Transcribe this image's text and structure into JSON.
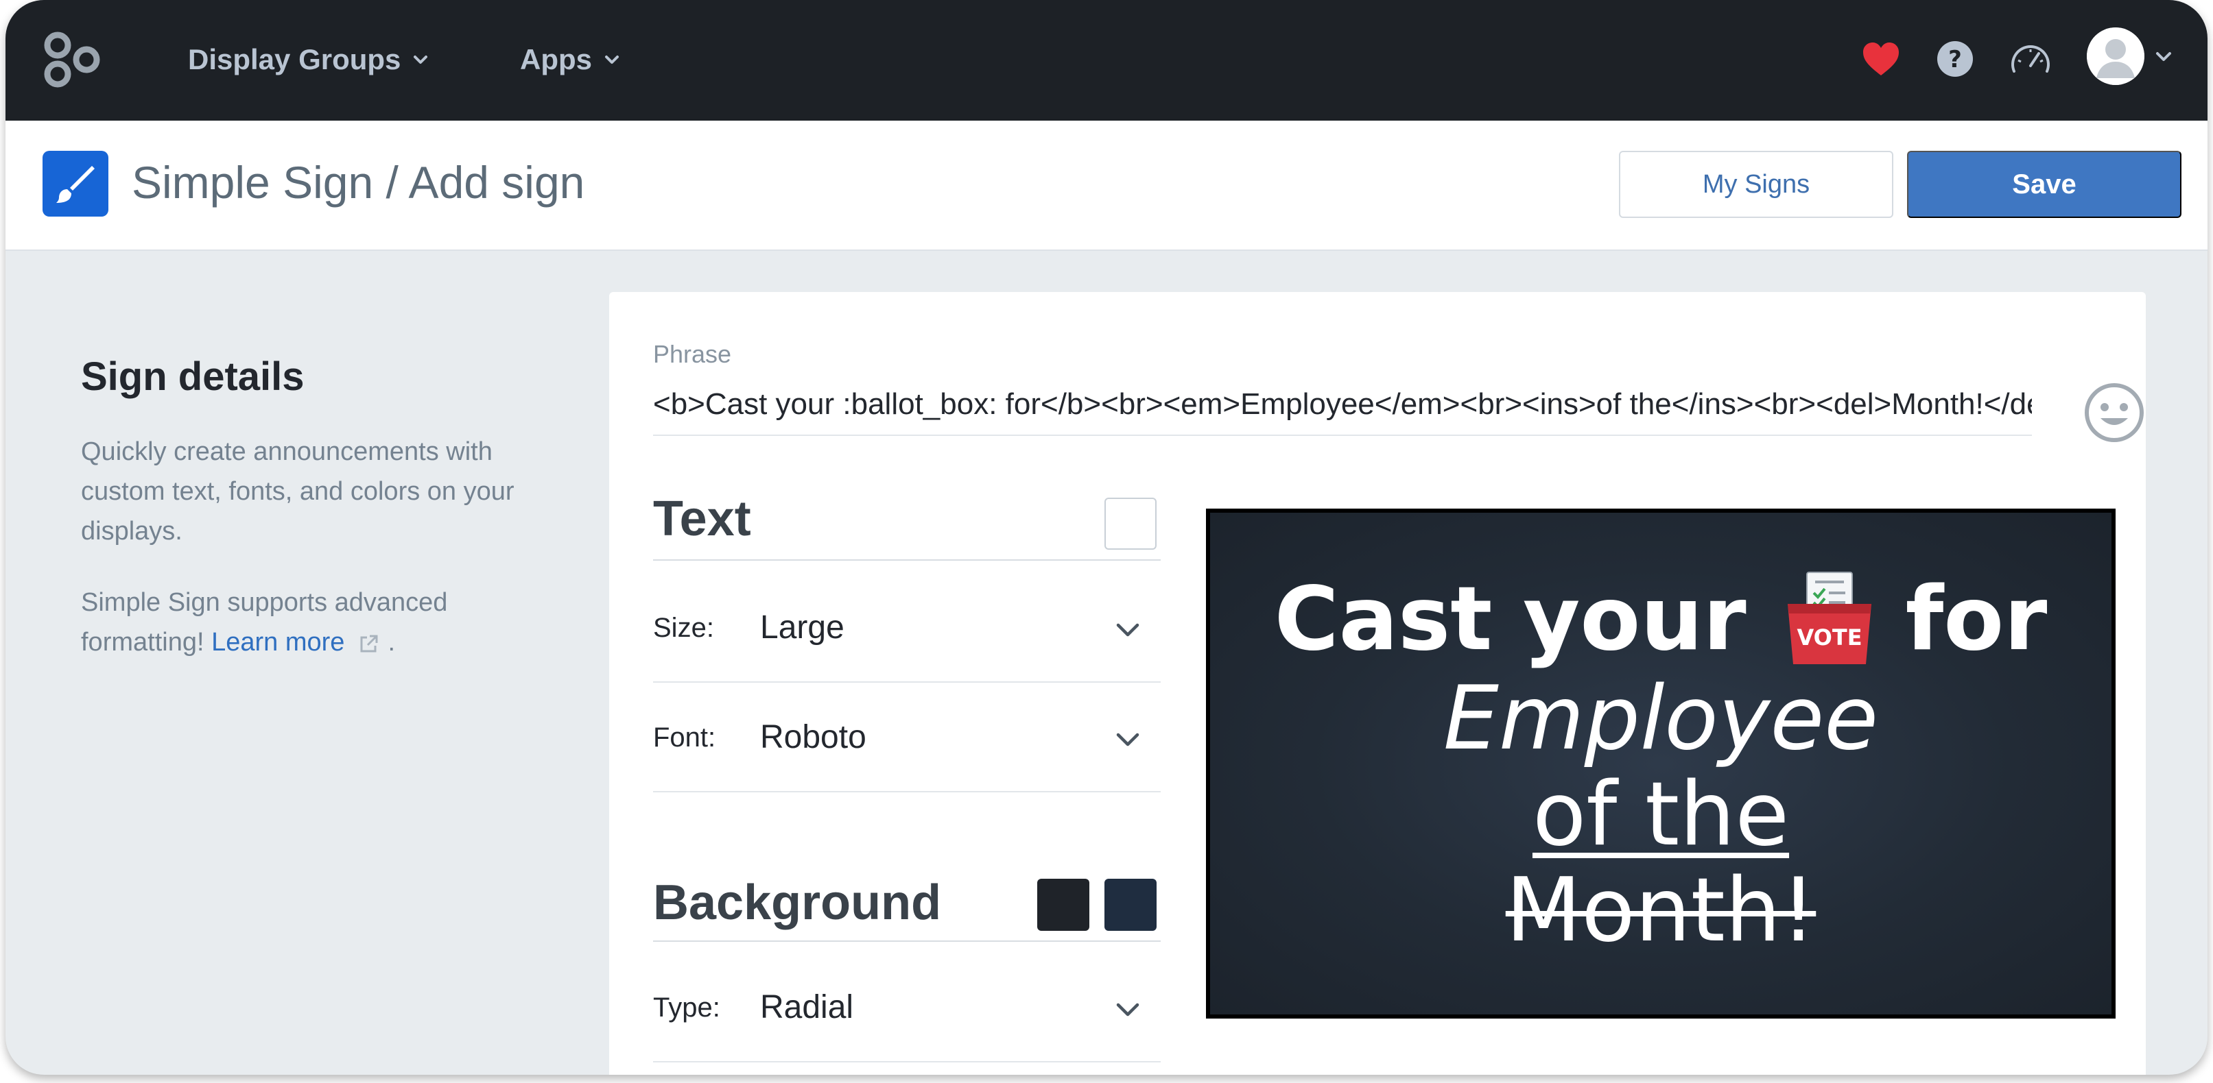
{
  "nav": {
    "items": [
      {
        "label": "Display Groups"
      },
      {
        "label": "Apps"
      }
    ],
    "colors": {
      "heart": "#e8323c",
      "bar": "#1d2126"
    }
  },
  "header": {
    "title": "Simple Sign / Add sign",
    "my_signs_label": "My Signs",
    "save_label": "Save"
  },
  "sidebar": {
    "heading": "Sign details",
    "description": "Quickly create announcements with custom text, fonts, and colors on your displays.",
    "formatting_prefix": "Simple Sign supports advanced formatting!",
    "learn_more": "Learn more",
    "formatting_suffix": "."
  },
  "form": {
    "phrase_label": "Phrase",
    "phrase_value": "<b>Cast your :ballot_box: for</b><br><em>Employee</em><br><ins>of the</ins><br><del>Month!</del>",
    "text_section": "Text",
    "size_label": "Size:",
    "size_value": "Large",
    "font_label": "Font:",
    "font_value": "Roboto",
    "background_section": "Background",
    "type_label": "Type:",
    "type_value": "Radial",
    "background_colors": [
      "#1f2329",
      "#1f2d40"
    ]
  },
  "preview": {
    "line1_before": "Cast your",
    "ballot_label": "VOTE",
    "line1_after": "for",
    "line2": "Employee",
    "line3": "of the",
    "line4": "Month!"
  }
}
